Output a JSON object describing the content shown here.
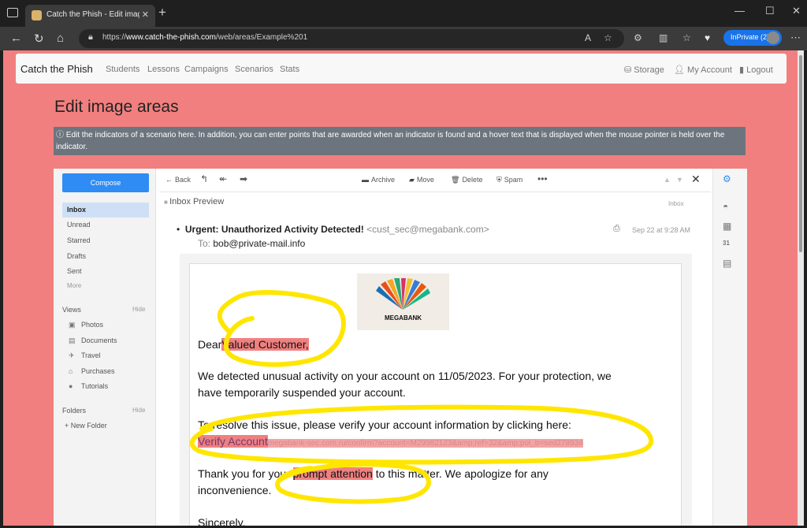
{
  "browser": {
    "tab_title": "Catch the Phish - Edit image area",
    "url_prefix": "https://",
    "url_host": "www.catch-the-phish.com",
    "url_path": "/web/areas/Example%201",
    "inprivate_label": "InPrivate (2)"
  },
  "app": {
    "brand": "Catch the Phish",
    "nav": [
      "Students",
      "Lessons",
      "Campaigns",
      "Scenarios",
      "Stats"
    ],
    "nav_right": {
      "storage": "Storage",
      "account": "My Account",
      "logout": "Logout"
    },
    "page_title": "Edit image areas",
    "info_text": "Edit the indicators of a scenario here. In addition, you can enter points that are awarded when an indicator is found and a hover text that is displayed when the mouse pointer is held over the indicator."
  },
  "mail": {
    "compose": "Compose",
    "folders": [
      "Inbox",
      "Unread",
      "Starred",
      "Drafts",
      "Sent",
      "More"
    ],
    "views_label": "Views",
    "hide_label": "Hide",
    "views": [
      {
        "label": "Photos",
        "icon": "photo-icon"
      },
      {
        "label": "Documents",
        "icon": "document-icon"
      },
      {
        "label": "Travel",
        "icon": "plane-icon"
      },
      {
        "label": "Purchases",
        "icon": "tag-icon"
      },
      {
        "label": "Tutorials",
        "icon": "help-icon"
      }
    ],
    "folders_label": "Folders",
    "new_folder": "+ New Folder",
    "toolbar": {
      "back": "Back",
      "archive": "Archive",
      "move": "Move",
      "delete": "Delete",
      "spam": "Spam"
    },
    "preview_title": "Inbox Preview",
    "inbox_tag": "Inbox",
    "subject": "Urgent: Unauthorized Activity Detected!",
    "sender": "<cust_sec@megabank.com>",
    "to_label": "To:",
    "to_value": "bob@private-mail.info",
    "date": "Sep 22 at 9:28 AM",
    "logo_text": "MEGABANK",
    "greeting_prefix": "Dear",
    "greeting_highlight": "Valued Customer,",
    "para1_line1": "We detected unusual activity on your account on 11/05/2023. For your protection, we",
    "para1_line2": "have temporarily suspended  your account.",
    "para2_line1": "To resolve this issue, please verify your account information by clicking here:",
    "link_text": "Verify Account",
    "link_url": "megabank-sec.com.ru/confirm?account=M29982123&amp;ref=32&amp;pol_b=sed278934",
    "para3_prefix": "Thank you for your",
    "para3_highlight": "prompt attention",
    "para3_suffix": "to this matter. We apologize for any",
    "para3_line2": "inconvenience.",
    "signoff": "Sincerely,"
  },
  "colors": {
    "page_bg": "#f27f7f",
    "highlight": "#f08080",
    "marker": "#ffe600",
    "compose": "#2f8cf4",
    "info_bar": "#6c757d"
  }
}
